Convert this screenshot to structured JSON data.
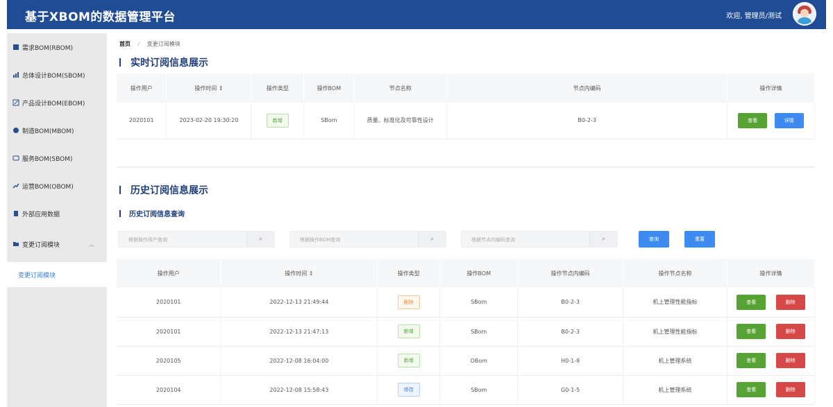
{
  "app": {
    "title": "基于XBOM的数据管理平台",
    "user_label": "欢迎, 管理员/测试"
  },
  "sidebar": {
    "items": [
      {
        "label": "需求BOM(RBOM)",
        "icon": "grid-icon"
      },
      {
        "label": "总体设计BOM(SBOM)",
        "icon": "chart-icon"
      },
      {
        "label": "产品设计BOM(EBOM)",
        "icon": "edit-icon"
      },
      {
        "label": "制造BOM(MBOM)",
        "icon": "gear-icon"
      },
      {
        "label": "服务BOM(SBOM)",
        "icon": "service-icon"
      },
      {
        "label": "运营BOM(OBOM)",
        "icon": "trend-icon"
      },
      {
        "label": "外部应用数据",
        "icon": "doc-icon"
      },
      {
        "label": "变更订阅模块",
        "icon": "folder-icon"
      }
    ],
    "active_sub": "变更订阅模块"
  },
  "breadcrumb": {
    "home": "首页",
    "sep": "/",
    "current": "变更订阅模块"
  },
  "realtime": {
    "title": "实时订阅信息展示",
    "headers": [
      "操作用户",
      "操作时间 ↕",
      "操作类型",
      "操作BOM",
      "节点名称",
      "节点内编码",
      "操作详情"
    ],
    "rows": [
      {
        "user": "2020101",
        "time": "2023-02-20 19:30:20",
        "type": "新增",
        "bom": "SBom",
        "node": "质量、标准化及可靠性设计",
        "code": "B0-2-3",
        "btn1": "查看",
        "btn2": "详情"
      }
    ]
  },
  "history": {
    "title": "历史订阅信息展示",
    "query_title": "历史订阅信息查询",
    "search": [
      {
        "placeholder": "根据操作用户查询"
      },
      {
        "placeholder": "根据操作BOM查询"
      },
      {
        "placeholder": "根据节点内编码查询"
      }
    ],
    "query_btn": "查询",
    "reset_btn": "重置",
    "headers": [
      "操作用户",
      "操作时间 ↕",
      "操作类型",
      "操作BOM",
      "操作节点内编码",
      "操作节点名称",
      "操作详情"
    ],
    "rows": [
      {
        "user": "2020101",
        "time": "2022-12-13 21:49:44",
        "type": "删除",
        "type_kind": "del",
        "bom": "SBom",
        "code": "B0-2-3",
        "node": "机上管理性能指标",
        "btn1": "查看",
        "btn2": "删除"
      },
      {
        "user": "2020101",
        "time": "2022-12-13 21:47:13",
        "type": "新增",
        "type_kind": "add",
        "bom": "SBom",
        "code": "B0-2-3",
        "node": "机上管理性能指标",
        "btn1": "查看",
        "btn2": "删除"
      },
      {
        "user": "2020105",
        "time": "2022-12-08 16:04:00",
        "type": "新增",
        "type_kind": "add",
        "bom": "OBom",
        "code": "H0-1-8",
        "node": "机上管理系统",
        "btn1": "查看",
        "btn2": "删除"
      },
      {
        "user": "2020104",
        "time": "2022-12-08 15:58:43",
        "type": "修改",
        "type_kind": "mod",
        "bom": "SBom",
        "code": "G0-1-5",
        "node": "机上管理系统",
        "btn1": "查看",
        "btn2": "删除"
      }
    ]
  },
  "colors": {
    "header": "#1f4c95",
    "primary": "#3d8af0",
    "success": "#57a333",
    "danger": "#d64747"
  }
}
